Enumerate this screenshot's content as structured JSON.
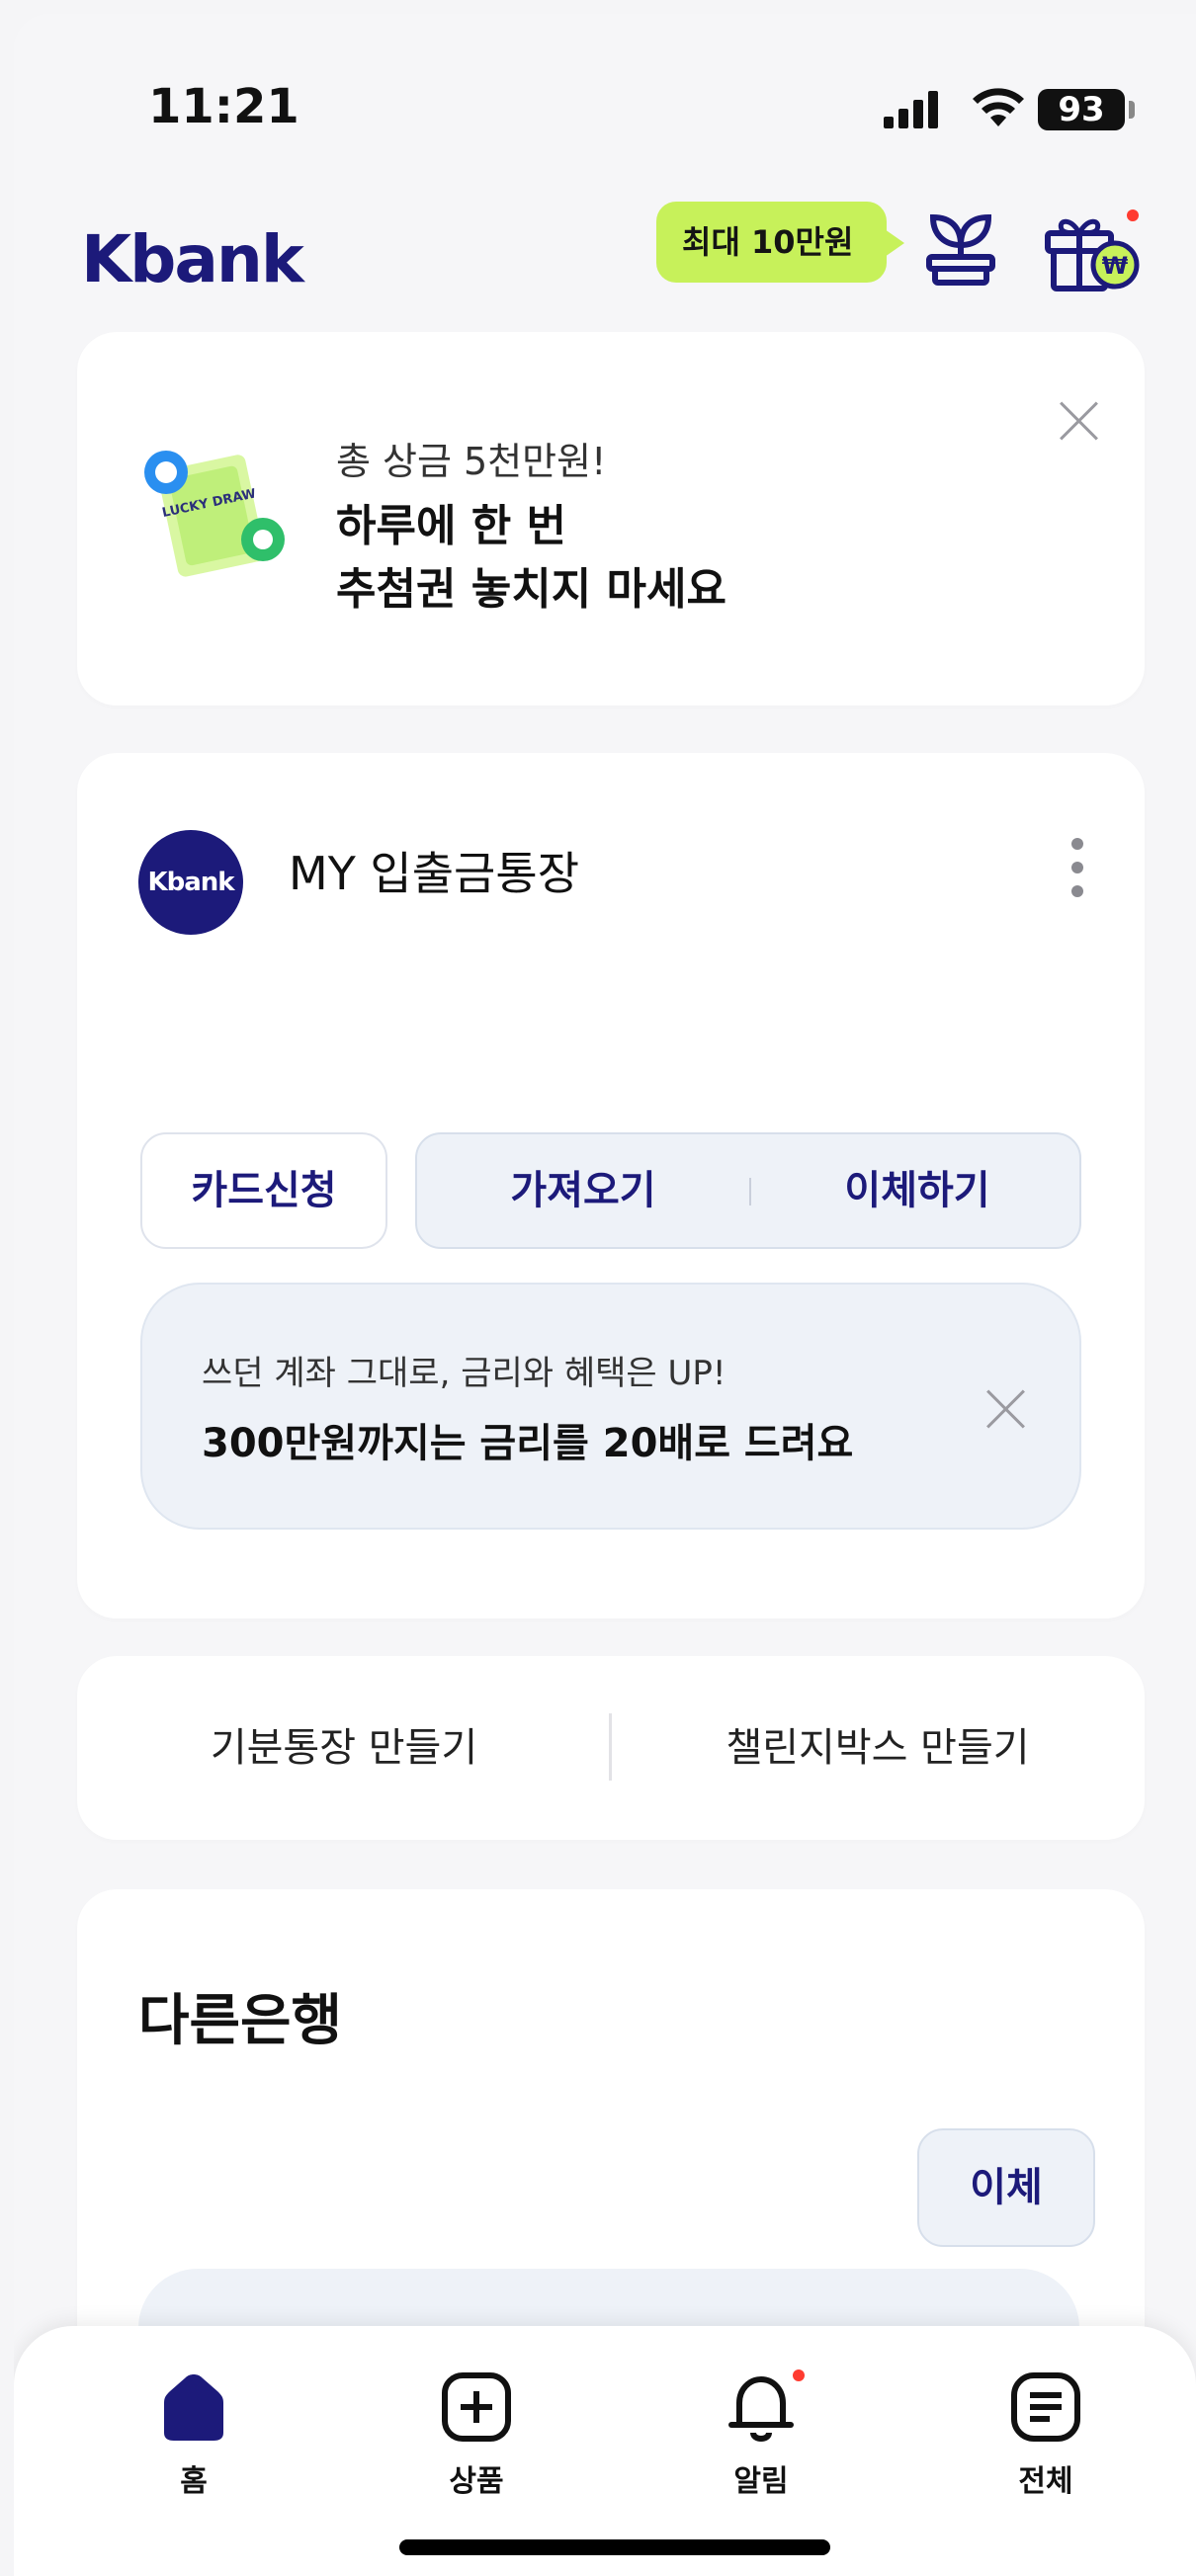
{
  "status_bar": {
    "time": "11:21",
    "battery": "93"
  },
  "header": {
    "logo": "Kbank",
    "promo_label": "최대 10만원"
  },
  "lucky_banner": {
    "subtitle": "총 상금 5천만원!",
    "title_line1": "하루에 한 번",
    "title_line2": "추첨권 놓치지 마세요",
    "art_text": "LUCKY DRAW"
  },
  "account": {
    "bank_logo": "Kbank",
    "name": "MY 입출금통장",
    "buttons": {
      "card": "카드신청",
      "fetch": "가져오기",
      "transfer": "이체하기"
    },
    "notice": {
      "subtitle": "쓰던 계좌 그대로, 금리와 혜택은 UP!",
      "title": "300만원까지는 금리를 20배로 드려요"
    }
  },
  "quick_actions": {
    "left": "기분통장 만들기",
    "right": "챌린지박스 만들기"
  },
  "other_bank": {
    "title": "다른은행",
    "transfer": "이체"
  },
  "tabbar": {
    "items": [
      {
        "label": "홈",
        "icon": "home-icon"
      },
      {
        "label": "상품",
        "icon": "plus-square-icon"
      },
      {
        "label": "알림",
        "icon": "bell-icon"
      },
      {
        "label": "전체",
        "icon": "menu-list-icon"
      }
    ]
  },
  "colors": {
    "brand": "#1c1a7a",
    "promo": "#c7f15a",
    "alert": "#ff3b30"
  }
}
